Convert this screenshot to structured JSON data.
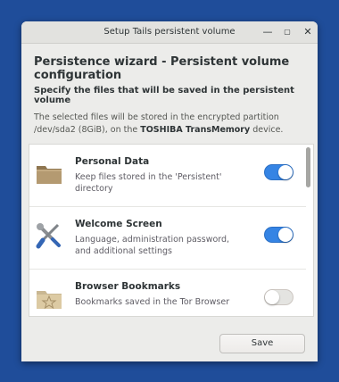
{
  "window": {
    "title": "Setup Tails persistent volume",
    "minimize_glyph": "—",
    "maximize_glyph": "▢",
    "close_glyph": "✕"
  },
  "header": "Persistence wizard - Persistent volume configuration",
  "subheader": "Specify the files that will be saved in the persistent volume",
  "description": {
    "prefix": "The selected files will be stored in the encrypted partition /dev/sda2 (8GiB), on the ",
    "device": "TOSHIBA TransMemory",
    "suffix": " device."
  },
  "features": [
    {
      "name": "Personal Data",
      "description": "Keep files stored in the 'Persistent' directory",
      "enabled": true,
      "icon": "folder-icon"
    },
    {
      "name": "Welcome Screen",
      "description": "Language, administration password, and additional settings",
      "enabled": true,
      "icon": "tools-icon"
    },
    {
      "name": "Browser Bookmarks",
      "description": "Bookmarks saved in the Tor Browser",
      "enabled": false,
      "icon": "bookmark-folder-icon"
    }
  ],
  "save_label": "Save",
  "colors": {
    "desktop": "#1f4d9a",
    "toggle_on": "#3584e4",
    "toggle_off": "#e4e4e1"
  }
}
